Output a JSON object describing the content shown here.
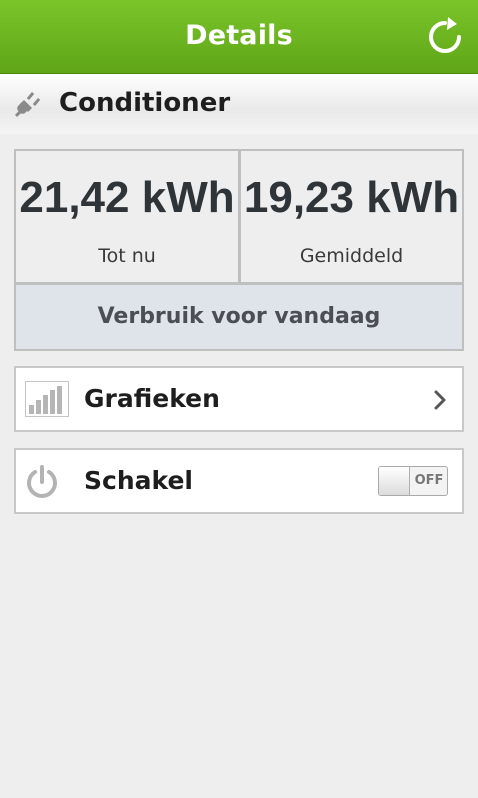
{
  "header": {
    "title": "Details",
    "refresh_icon": "refresh-icon",
    "color": "#6db520"
  },
  "device": {
    "name": "Conditioner",
    "icon": "plug-icon"
  },
  "stats": {
    "total": {
      "value": "21,42 kWh",
      "label": "Tot nu"
    },
    "average": {
      "value": "19,23 kWh",
      "label": "Gemiddeld"
    },
    "today_label": "Verbruik voor vandaag"
  },
  "menu": {
    "charts": {
      "label": "Grafieken",
      "icon": "bar-chart-icon",
      "chevron": "chevron-right-icon"
    },
    "switch": {
      "label": "Schakel",
      "icon": "power-icon",
      "toggle_state": "OFF"
    }
  }
}
